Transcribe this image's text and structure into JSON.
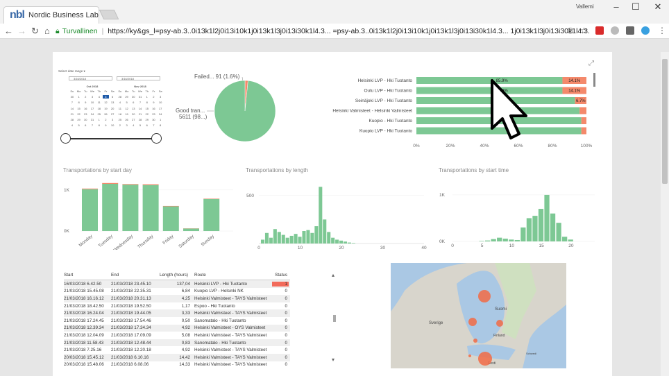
{
  "browser": {
    "tab_title": "Nordic Business Lab",
    "tab_logo": "nbl",
    "user": "Vallemi",
    "secure_label": "Turvallinen",
    "url": "https://ky&gs_l=psy-ab.3..0i13k1l2j0i13i10k1j0i13k1l3j0i13i30k1l4.3... =psy-ab.3..0i13k1l2j0i13i10k1j0i13k1l3j0i13i30k1l4.3... 1j0i13k1l3j0i13i30k1l4.3...",
    "window_buttons": [
      "–",
      "☐",
      "✕"
    ],
    "nav_icons": [
      "back-icon",
      "forward-icon",
      "reload-icon",
      "home-icon"
    ]
  },
  "date_filter": {
    "label": "Select date range ▾",
    "from": "3/16/2018",
    "to": "3/16/2018",
    "months": [
      {
        "title": "Oct 2018",
        "weekdays": [
          "Su",
          "Mo",
          "Tu",
          "We",
          "Th",
          "Fr",
          "Sa"
        ],
        "days": [
          "30",
          "1",
          "2",
          "3",
          "4",
          "5",
          "6",
          "7",
          "8",
          "9",
          "10",
          "11",
          "12",
          "13",
          "14",
          "15",
          "16",
          "17",
          "18",
          "19",
          "20",
          "21",
          "22",
          "23",
          "24",
          "25",
          "26",
          "27",
          "28",
          "29",
          "30",
          "31",
          "1",
          "2",
          "3",
          "4",
          "5",
          "6",
          "7",
          "8",
          "9",
          "10"
        ],
        "selected": "5"
      },
      {
        "title": "Nov 2018",
        "weekdays": [
          "Su",
          "Mo",
          "Tu",
          "We",
          "Th",
          "Fr",
          "Sa"
        ],
        "days": [
          "28",
          "29",
          "30",
          "31",
          "1",
          "2",
          "3",
          "4",
          "5",
          "6",
          "7",
          "8",
          "9",
          "10",
          "11",
          "12",
          "13",
          "14",
          "15",
          "16",
          "17",
          "18",
          "19",
          "20",
          "21",
          "22",
          "23",
          "24",
          "25",
          "26",
          "27",
          "28",
          "29",
          "30",
          "1",
          "2",
          "3",
          "4",
          "5",
          "6",
          "7",
          "8"
        ]
      }
    ],
    "range_low": 0,
    "range_high": 1
  },
  "pie": {
    "failed_label": "Failed... 91 (1.6%)",
    "good_label_1": "Good tran...",
    "good_label_2": "5611 (98...)"
  },
  "sections": {
    "by_day": "Transportations by start day",
    "by_length": "Transportations by length",
    "by_time": "Transportations by start time"
  },
  "chart_data": [
    {
      "type": "pie",
      "categories": [
        "Failed...",
        "Good tran..."
      ],
      "values": [
        91,
        5611
      ],
      "colors": [
        "#f4896b",
        "#7dc894"
      ]
    },
    {
      "type": "bar",
      "orientation": "horizontal",
      "stacked": true,
      "categories": [
        "Helsinki LVP - Hki Tuotanto",
        "Oulu LVP - Hki Tuotanto",
        "Seinäjoki LVP - Hki Tuotanto",
        "Helsinki Valmisteet - Helsinki Valmisteet",
        "Kuopio - Hki Tuotanto",
        "Kuopio LVP - Hki Tuotanto"
      ],
      "series": [
        {
          "values": [
            85.9,
            85.9,
            93.3,
            96,
            97,
            97
          ]
        },
        {
          "values": [
            14.1,
            14.1,
            6.7,
            4,
            3,
            3
          ]
        }
      ],
      "data_labels": [
        [
          "85.9%",
          "14.1%"
        ],
        [
          "85.9%",
          "14.1%"
        ],
        [
          "9",
          "6.7%"
        ],
        [
          "",
          ""
        ],
        [
          "",
          ""
        ],
        [
          "1%",
          ""
        ]
      ],
      "xticks": [
        "0%",
        "20%",
        "40%",
        "60%",
        "80%",
        "100%"
      ],
      "xlim": [
        0,
        100
      ],
      "colors": [
        "#7dc894",
        "#f4896b"
      ]
    },
    {
      "type": "bar",
      "categories": [
        "Monday",
        "Tuesday",
        "Wednesday",
        "Thursday",
        "Friday",
        "Saturday",
        "Sunday"
      ],
      "series": [
        {
          "values": [
            1020,
            1150,
            1130,
            1120,
            600,
            60,
            780
          ]
        },
        {
          "values": [
            15,
            20,
            15,
            20,
            10,
            5,
            10
          ]
        }
      ],
      "yticks": [
        "0K",
        "1K"
      ],
      "ylim": [
        0,
        1400
      ],
      "colors": [
        "#7dc894",
        "#f4896b"
      ]
    },
    {
      "type": "bar",
      "x": [
        1,
        2,
        3,
        4,
        5,
        6,
        7,
        8,
        9,
        10,
        11,
        12,
        13,
        14,
        15,
        16,
        17,
        18,
        19,
        20,
        21,
        22,
        23
      ],
      "values": [
        40,
        110,
        60,
        150,
        120,
        90,
        60,
        80,
        100,
        70,
        130,
        140,
        110,
        180,
        590,
        250,
        120,
        60,
        40,
        30,
        20,
        10,
        5
      ],
      "xticks": [
        "0",
        "10",
        "20",
        "30",
        "40"
      ],
      "yticks": [
        "500"
      ],
      "xlim": [
        0,
        40
      ],
      "ylim": [
        0,
        650
      ],
      "color": "#7dc894"
    },
    {
      "type": "bar",
      "x": [
        5,
        6,
        7,
        8,
        9,
        10,
        11,
        12,
        13,
        14,
        15,
        16,
        17,
        18,
        19,
        20
      ],
      "values": [
        10,
        20,
        50,
        80,
        60,
        40,
        30,
        300,
        500,
        550,
        700,
        1000,
        600,
        400,
        100,
        40
      ],
      "xticks": [
        "0",
        "5",
        "10",
        "15",
        "20"
      ],
      "yticks": [
        "0K",
        "1K"
      ],
      "xlim": [
        0,
        24
      ],
      "ylim": [
        0,
        1200
      ],
      "color": "#7dc894"
    }
  ],
  "table": {
    "headers": [
      "Start",
      "End",
      "Length (hours)",
      "Route",
      "Status"
    ],
    "rows": [
      [
        "16/03/2018 6.42.50",
        "21/03/2018 23.45.10",
        "137,04",
        "Helsinki LVP - Hki Tuotanto",
        "1"
      ],
      [
        "21/03/2018 15.45.08",
        "21/03/2018 22.35.31",
        "6,84",
        "Kuopio LVP - Helsinki NK",
        "0"
      ],
      [
        "21/03/2018 16.16.12",
        "21/03/2018 20.31.13",
        "4,25",
        "Helsinki Valmisteet - TAYS Valmisteet",
        "0"
      ],
      [
        "21/03/2018 18.42.50",
        "21/03/2018 19.52.50",
        "1,17",
        "Espoo - Hki Tuotanto",
        "0"
      ],
      [
        "21/03/2018 16.24.04",
        "21/03/2018 19.44.05",
        "3,33",
        "Helsinki Valmisteet - TAYS Valmisteet",
        "0"
      ],
      [
        "21/03/2018 17.24.45",
        "21/03/2018 17.54.46",
        "0,50",
        "Sanomatalo - Hki Tuotanto",
        "0"
      ],
      [
        "21/03/2018 12.39.34",
        "21/03/2018 17.34.34",
        "4,92",
        "Helsinki Valmisteet - OYS Valmisteet",
        "0"
      ],
      [
        "21/03/2018 12.04.09",
        "21/03/2018 17.09.09",
        "5,08",
        "Helsinki Valmisteet - TAYS Valmisteet",
        "0"
      ],
      [
        "21/03/2018 11.58.43",
        "21/03/2018 12.48.44",
        "0,83",
        "Sanomatalo - Hki Tuotanto",
        "0"
      ],
      [
        "21/03/2018 7.25.16",
        "21/03/2018 12.20.18",
        "4,92",
        "Helsinki Valmisteet - TAYS Valmisteet",
        "0"
      ],
      [
        "20/03/2018 15.45.12",
        "21/03/2018 6.10.16",
        "14,42",
        "Helsinki Valmisteet - TAYS Valmisteet",
        "0"
      ],
      [
        "20/03/2018 15.48.06",
        "21/03/2018 6.08.06",
        "14,33",
        "Helsinki Valmisteet - TAYS Valmisteet",
        "0"
      ]
    ]
  },
  "map": {
    "labels": [
      "Sverige",
      "Suomi",
      "Finland",
      "Eesti",
      "Schwedi"
    ]
  }
}
